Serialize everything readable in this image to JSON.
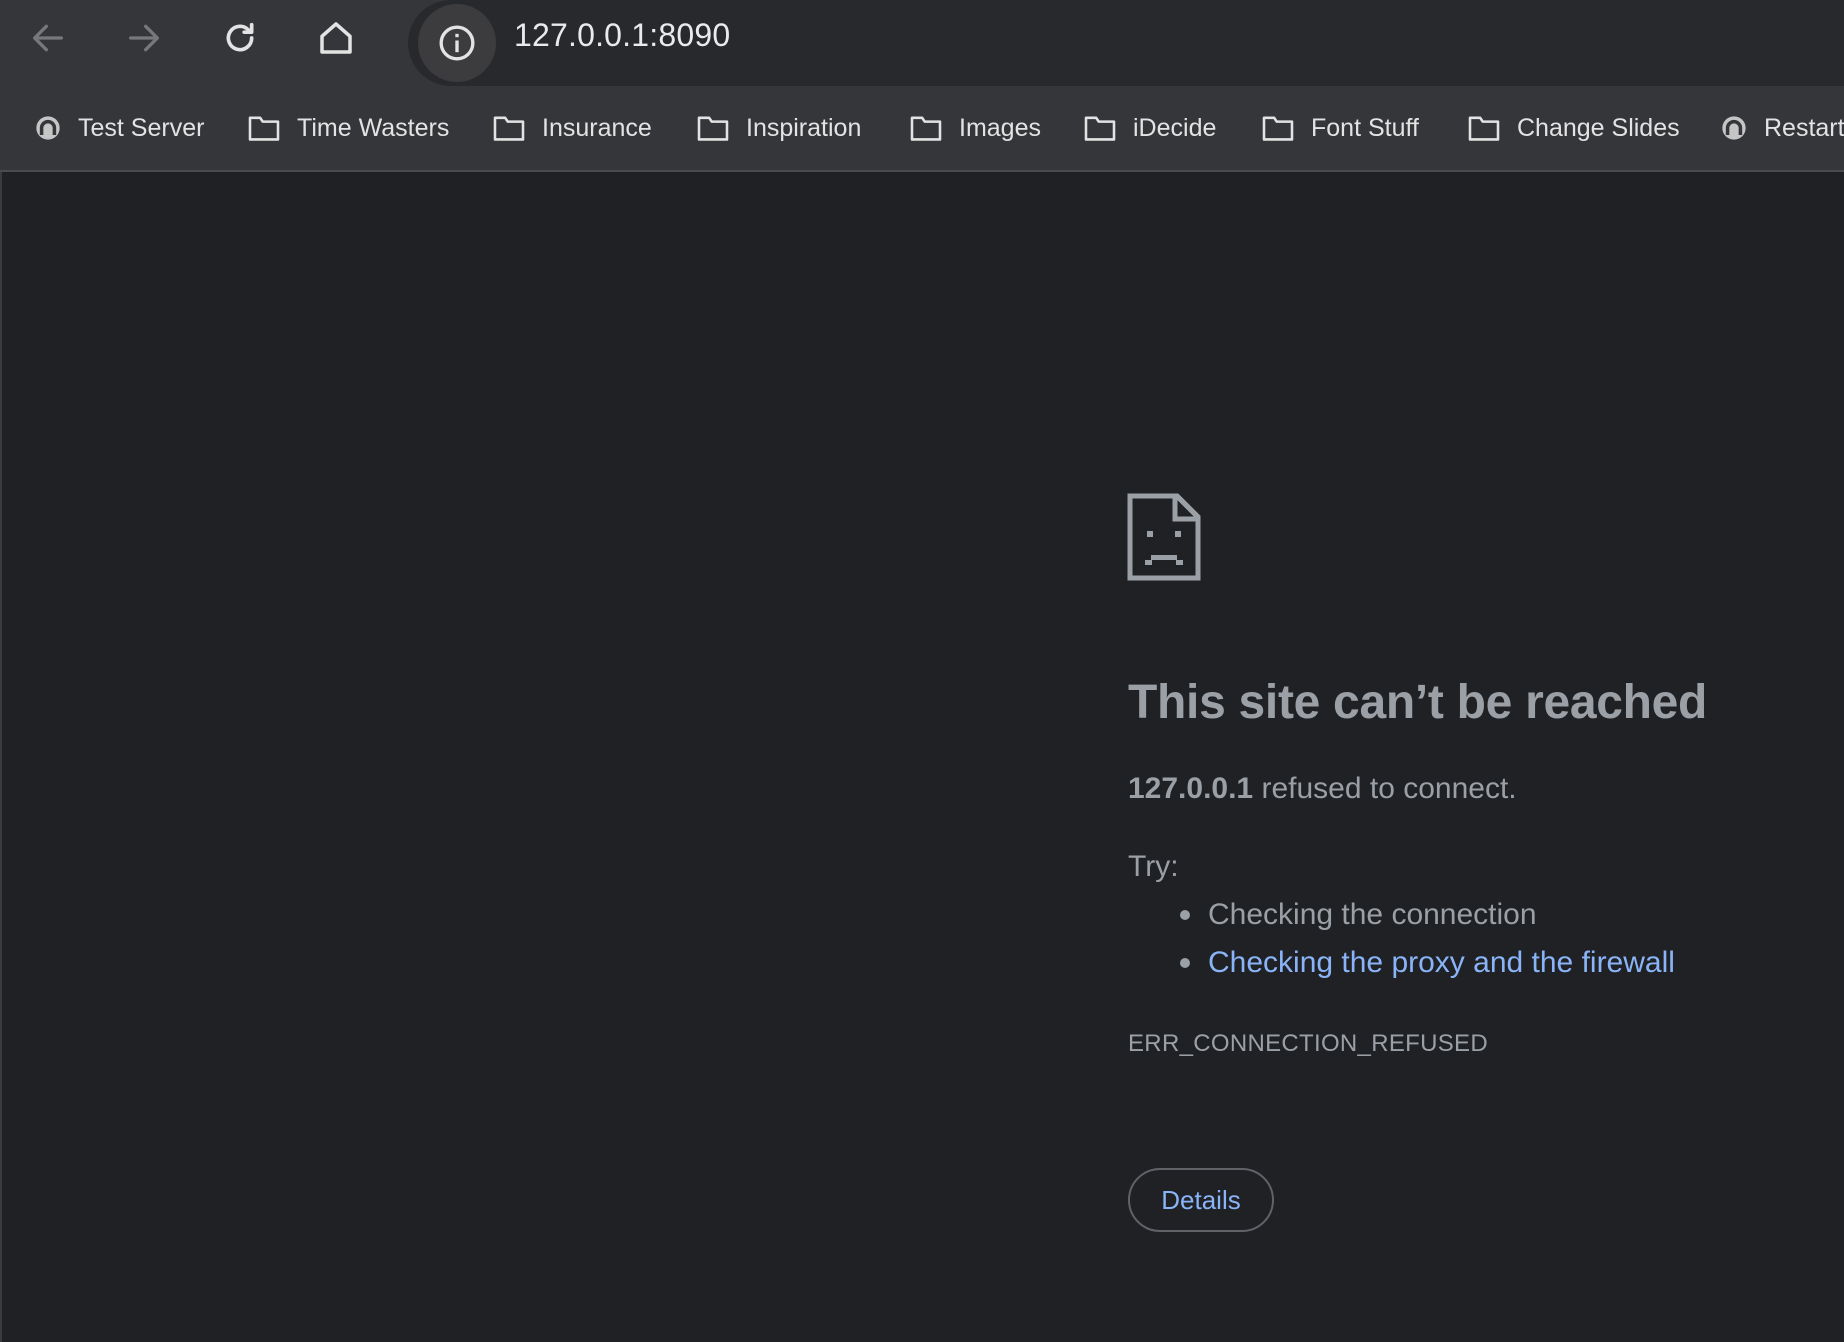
{
  "browser": {
    "url": "127.0.0.1:8090",
    "bookmarks": [
      {
        "label": "Test Server",
        "icon": "site-icon"
      },
      {
        "label": "Time Wasters",
        "icon": "folder-icon"
      },
      {
        "label": "Insurance",
        "icon": "folder-icon"
      },
      {
        "label": "Inspiration",
        "icon": "folder-icon"
      },
      {
        "label": "Images",
        "icon": "folder-icon"
      },
      {
        "label": "iDecide",
        "icon": "folder-icon"
      },
      {
        "label": "Font Stuff",
        "icon": "folder-icon"
      },
      {
        "label": "Change Slides",
        "icon": "folder-icon"
      },
      {
        "label": "Restart",
        "icon": "site-icon"
      }
    ]
  },
  "error_page": {
    "icon": "sad-page-icon",
    "headline": "This site can’t be reached",
    "host": "127.0.0.1",
    "message": "refused to connect.",
    "try_label": "Try:",
    "suggestions": [
      {
        "text": "Checking the connection",
        "link": false
      },
      {
        "text": "Checking the proxy and the firewall",
        "link": true
      }
    ],
    "error_code": "ERR_CONNECTION_REFUSED",
    "details_label": "Details"
  },
  "colors": {
    "toolbar": "#35363a",
    "page_bg": "#202124",
    "text": "#9aa0a6",
    "link": "#8ab4f8"
  }
}
